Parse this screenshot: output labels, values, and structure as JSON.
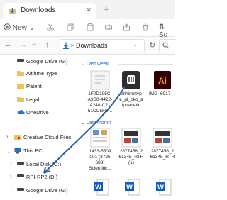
{
  "window": {
    "tab_title": "Downloads",
    "tab_close": "×",
    "new_tab": "+"
  },
  "toolbar": {
    "new_label": "New",
    "new_chevron": "⌄",
    "sort_label": "So"
  },
  "address": {
    "back": "←",
    "forward": "→",
    "up": "↑",
    "chevron": "⌄",
    "refresh": "↻",
    "sep": ">",
    "path": "Downloads"
  },
  "sidebar": {
    "items": [
      {
        "label": "Google Drive (G:)"
      },
      {
        "label": "Aitihme Type"
      },
      {
        "label": "Patent"
      },
      {
        "label": "Legal"
      },
      {
        "label": "OneDrive"
      },
      {
        "label": "Creative Cloud Files"
      },
      {
        "label": "This PC"
      },
      {
        "label": "Local Disk (C:)"
      },
      {
        "label": "RPI-RP2 (D:)"
      },
      {
        "label": "Google Drive (G:)"
      }
    ]
  },
  "groups": {
    "last_week": "Last week",
    "last_month": "Last month"
  },
  "files": [
    {
      "name": "1F0D195C-A3B0-4422-A248-C21 51CC5FD..."
    },
    {
      "name": "aithimetyp e_pl_pko_a lphabetic"
    },
    {
      "name": "IMG_6917"
    },
    {
      "name": "1433-5809 -001 (3725-683) Scientific..."
    },
    {
      "name": "2877458_2 61345_RTR (1)"
    },
    {
      "name": "2877458_2 61345_RTR"
    }
  ],
  "colors": {
    "accent": "#2a6ebb",
    "folder": "#f2c14e",
    "annotation": "#2a5cac"
  }
}
